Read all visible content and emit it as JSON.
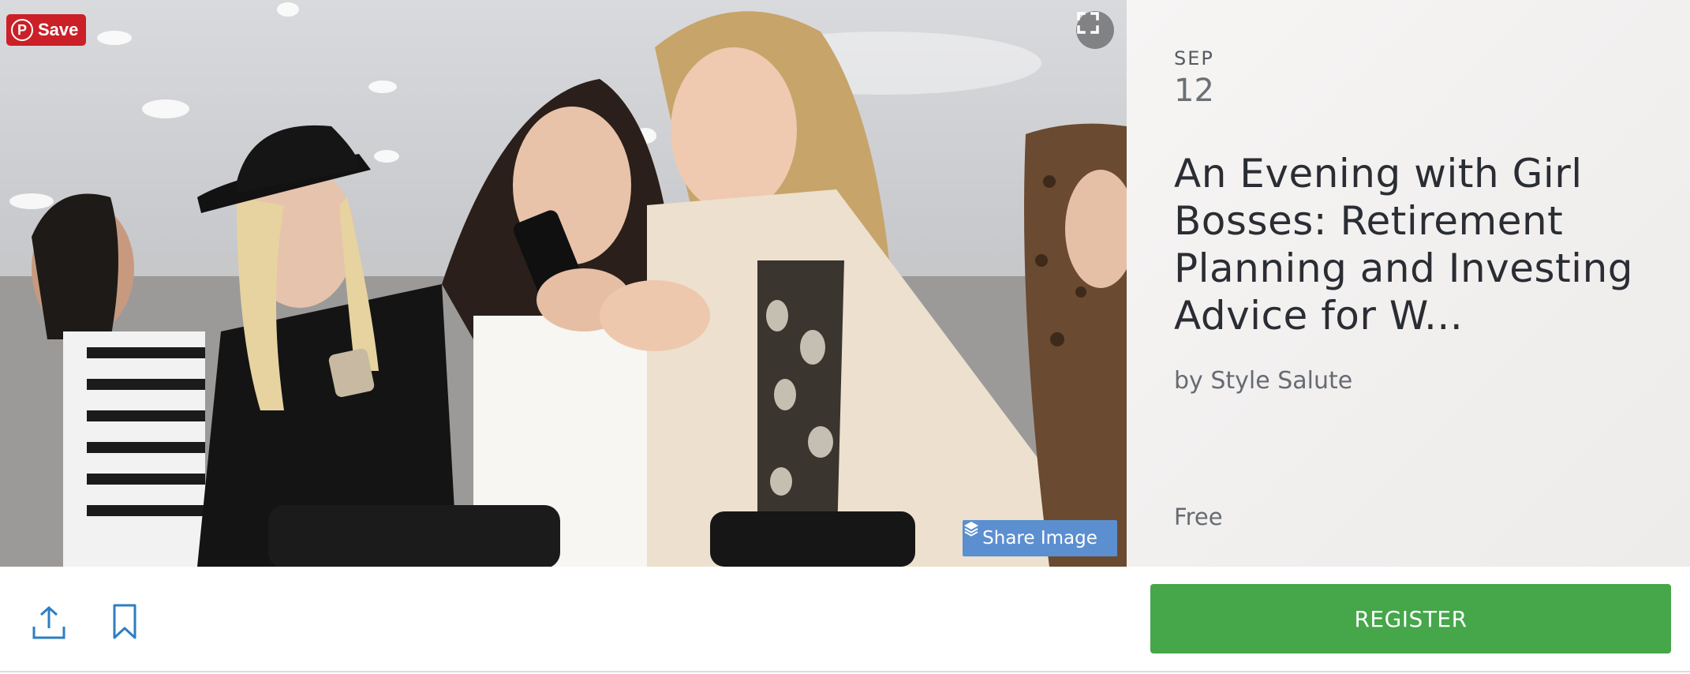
{
  "hero": {
    "pin_save_label": "Save",
    "share_image_label": "Share Image"
  },
  "event": {
    "month": "SEP",
    "day": "12",
    "title": "An Evening with Girl Bosses: Retirement Planning and Investing Advice for W...",
    "organizer": "by Style Salute",
    "price": "Free"
  },
  "actions": {
    "register_label": "REGISTER"
  },
  "colors": {
    "register_green": "#45a64a",
    "pinterest_red": "#cb2027",
    "share_blue": "#5b8fd0",
    "icon_blue": "#2d7ec2"
  },
  "icons": [
    "pinterest-icon",
    "expand-icon",
    "layers-icon",
    "share-icon",
    "bookmark-icon"
  ]
}
